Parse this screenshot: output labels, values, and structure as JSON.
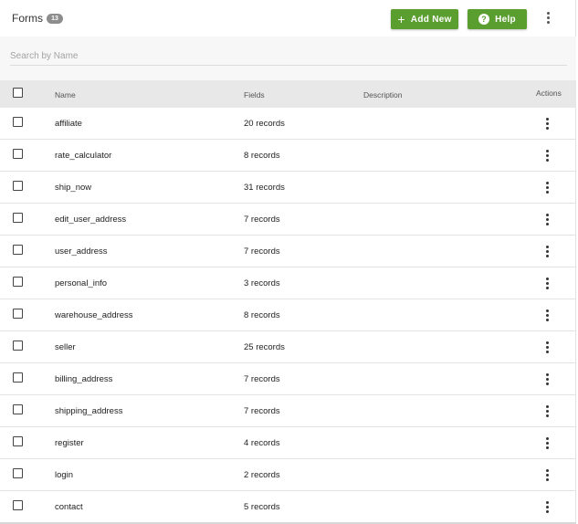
{
  "header": {
    "title": "Forms",
    "count_badge": "13",
    "add_button_label": "Add New",
    "help_button_label": "Help",
    "help_icon_glyph": "?",
    "plus_icon_glyph": "+"
  },
  "search": {
    "placeholder": "Search by Name",
    "value": ""
  },
  "table": {
    "columns": {
      "name": "Name",
      "fields": "Fields",
      "description": "Description",
      "actions": "Actions"
    },
    "rows": [
      {
        "name": "affiliate",
        "fields": "20 records",
        "description": ""
      },
      {
        "name": "rate_calculator",
        "fields": "8 records",
        "description": ""
      },
      {
        "name": "ship_now",
        "fields": "31 records",
        "description": ""
      },
      {
        "name": "edit_user_address",
        "fields": "7 records",
        "description": ""
      },
      {
        "name": "user_address",
        "fields": "7 records",
        "description": ""
      },
      {
        "name": "personal_info",
        "fields": "3 records",
        "description": ""
      },
      {
        "name": "warehouse_address",
        "fields": "8 records",
        "description": ""
      },
      {
        "name": "seller",
        "fields": "25 records",
        "description": ""
      },
      {
        "name": "billing_address",
        "fields": "7 records",
        "description": ""
      },
      {
        "name": "shipping_address",
        "fields": "7 records",
        "description": ""
      },
      {
        "name": "register",
        "fields": "4 records",
        "description": ""
      },
      {
        "name": "login",
        "fields": "2 records",
        "description": ""
      },
      {
        "name": "contact",
        "fields": "5 records",
        "description": ""
      }
    ]
  },
  "colors": {
    "accent_green": "#5a9e2f",
    "badge_gray": "#8d8d8d",
    "header_bg": "#e8e8e8",
    "search_bg": "#f7f7f7"
  },
  "icons": {
    "header_menu": "more-vertical-icon",
    "row_menu": "more-vertical-icon",
    "add": "plus-icon",
    "help": "help-circle-icon"
  }
}
